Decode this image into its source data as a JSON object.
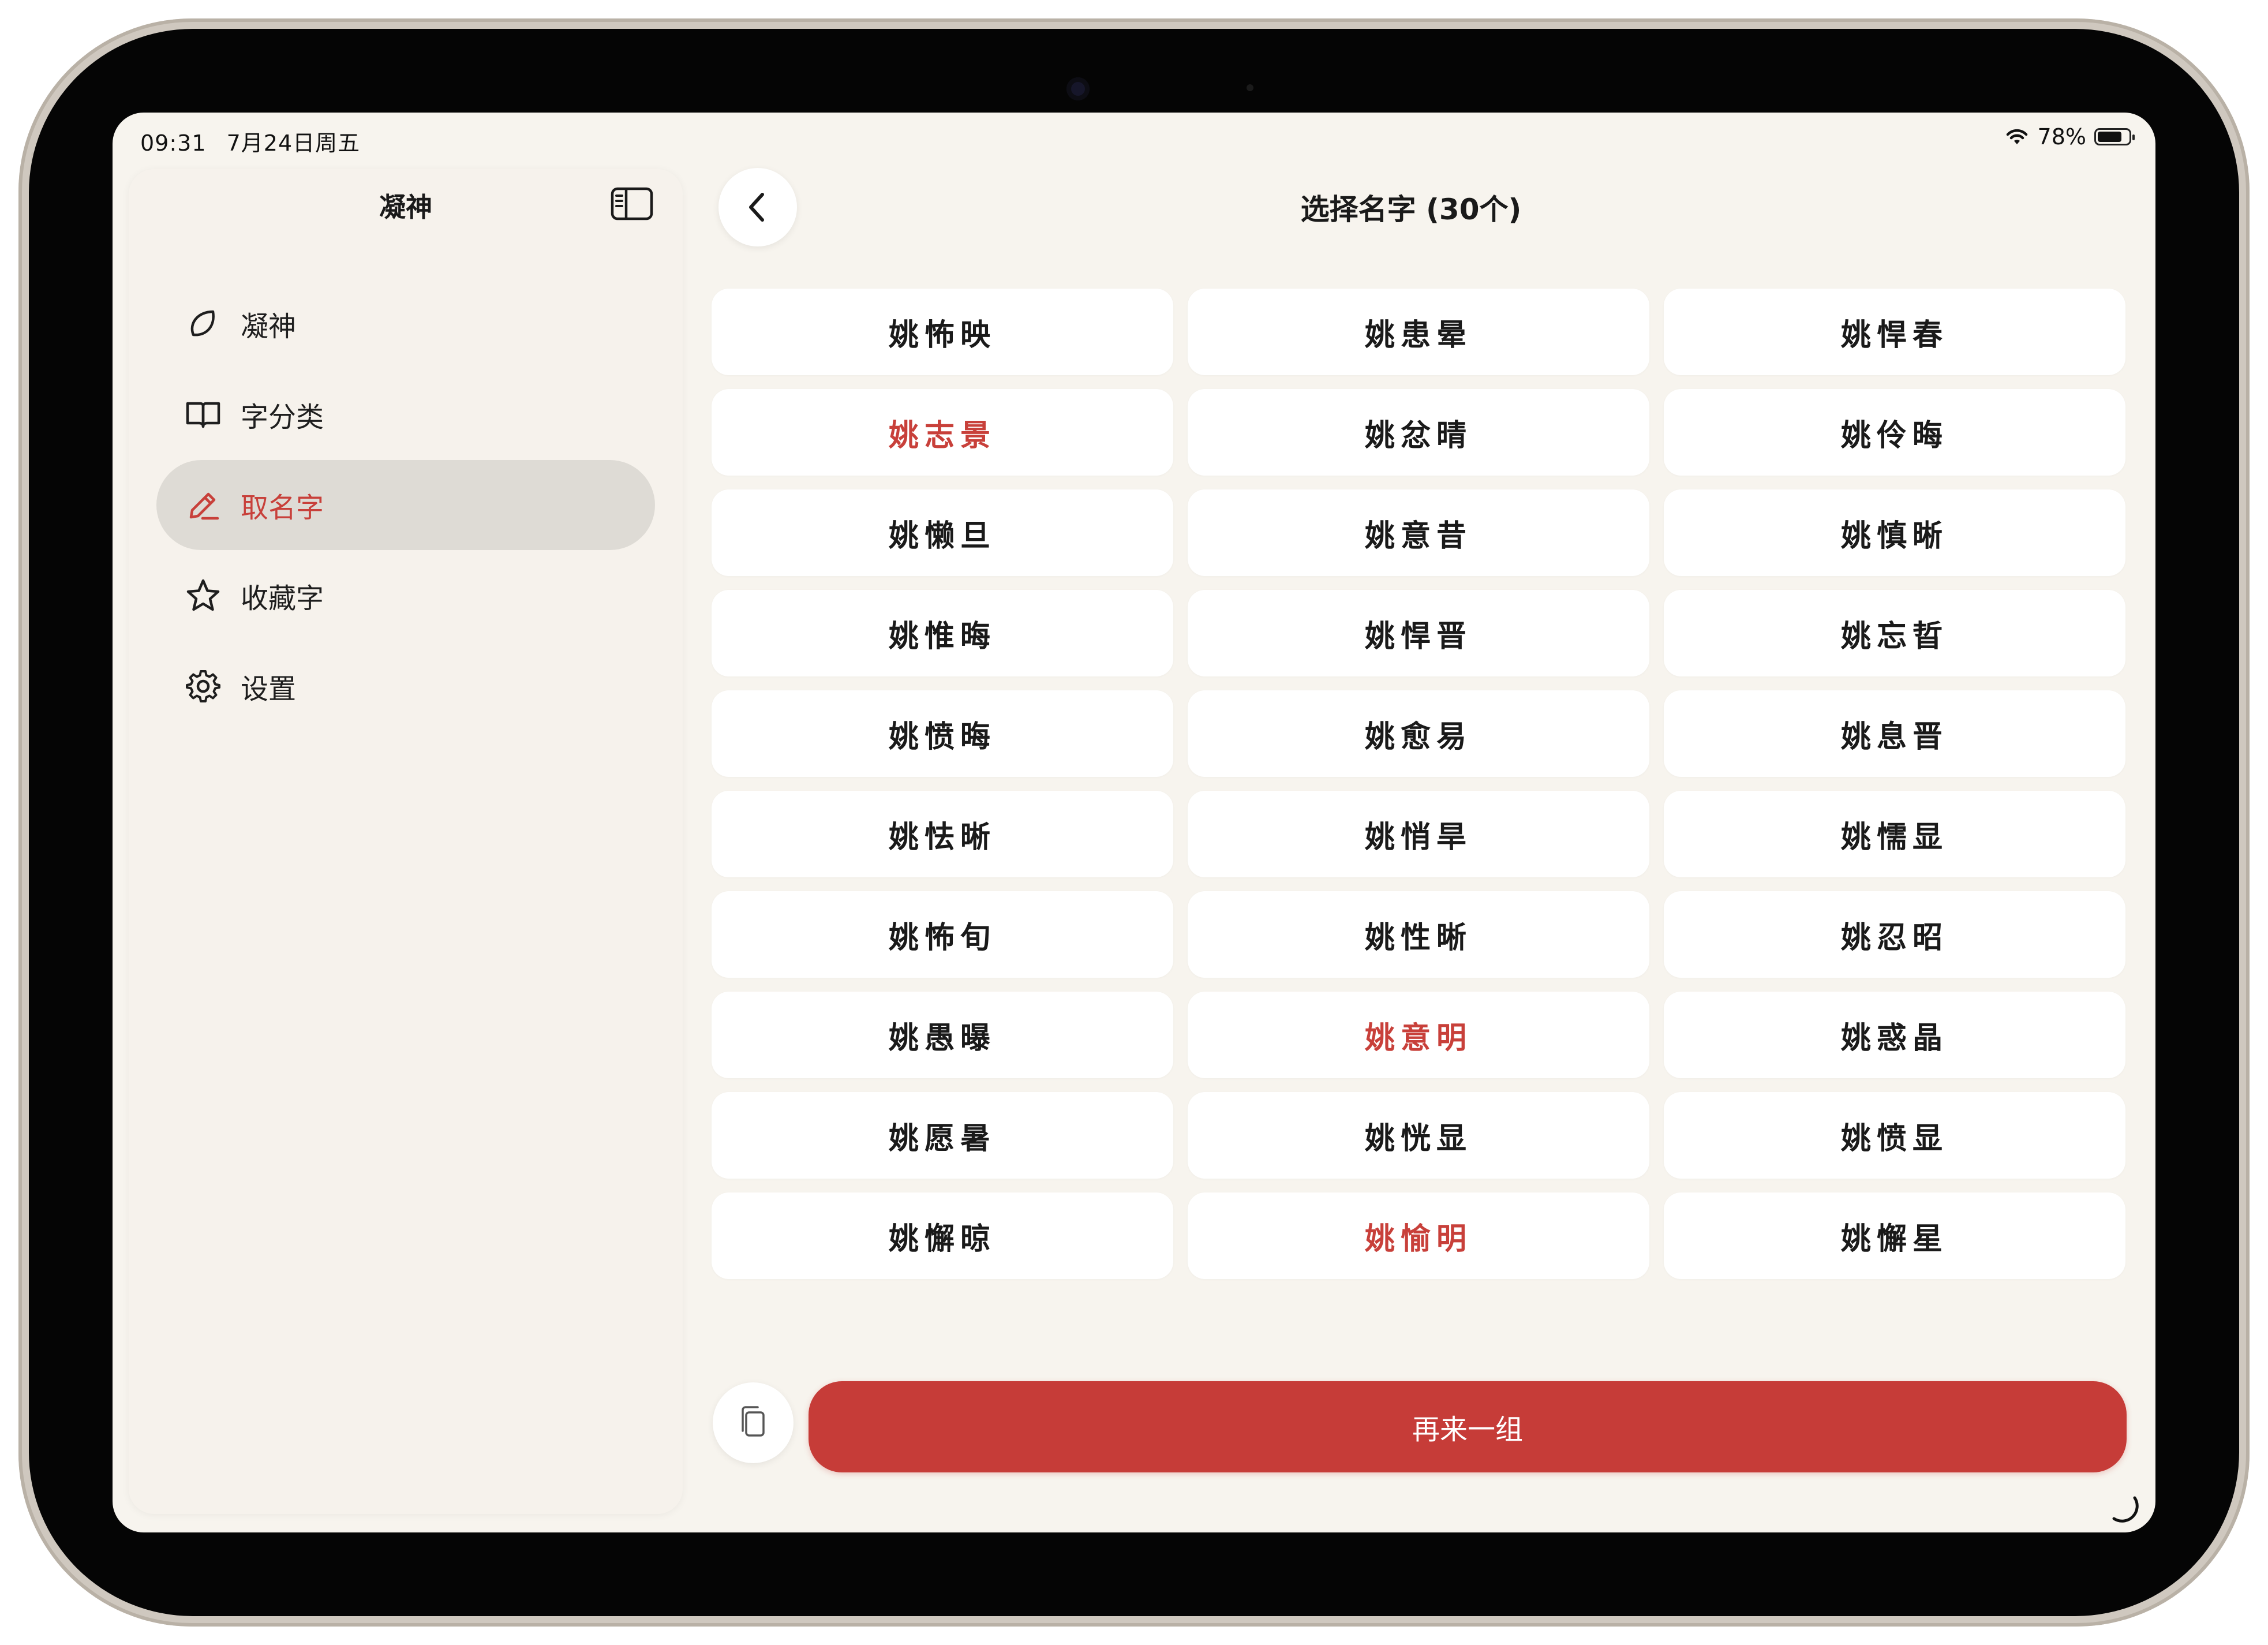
{
  "status_bar": {
    "time": "09:31",
    "date": "7月24日周五",
    "battery": "78%"
  },
  "sidebar": {
    "title": "凝神",
    "items": [
      {
        "label": "凝神",
        "icon": "leaf-icon",
        "active": false
      },
      {
        "label": "字分类",
        "icon": "book-icon",
        "active": false
      },
      {
        "label": "取名字",
        "icon": "pencil-icon",
        "active": true
      },
      {
        "label": "收藏字",
        "icon": "star-icon",
        "active": false
      },
      {
        "label": "设置",
        "icon": "gear-icon",
        "active": false
      }
    ]
  },
  "main": {
    "title": "选择名字 (30个)",
    "names": [
      "姚怖映",
      "姚患晕",
      "姚悍春",
      "姚志景",
      "姚忿晴",
      "姚伶晦",
      "姚懒旦",
      "姚意昔",
      "姚慎晰",
      "姚惟晦",
      "姚悍晋",
      "姚忘晢",
      "姚愤晦",
      "姚愈易",
      "姚息晋",
      "姚怯晰",
      "姚悄旱",
      "姚懦显",
      "姚怖旬",
      "姚性晰",
      "姚忍昭",
      "姚愚曝",
      "姚意明",
      "姚惑晶",
      "姚愿暑",
      "姚恍显",
      "姚愤显",
      "姚懈晾",
      "姚愉明",
      "姚懈星"
    ],
    "highlighted": [
      "姚志景",
      "姚意明",
      "姚愉明"
    ],
    "again_button": "再来一组"
  },
  "colors": {
    "accent": "#c63c38",
    "background": "#f7f4ee",
    "selected_nav": "#dedbd5"
  }
}
